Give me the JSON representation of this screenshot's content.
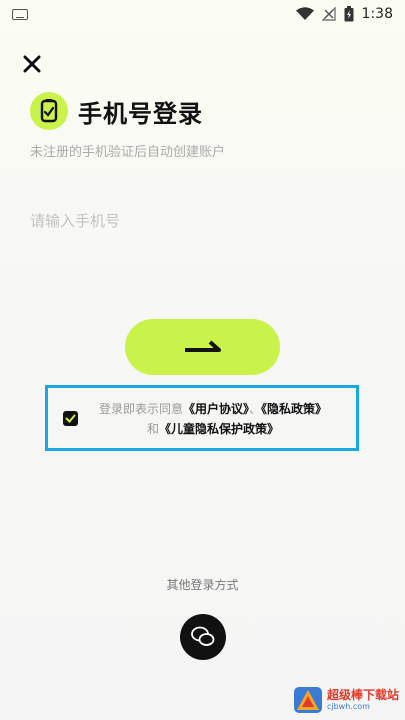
{
  "status_bar": {
    "time": "1:38"
  },
  "header": {
    "title": "手机号登录",
    "subtitle": "未注册的手机验证后自动创建账户"
  },
  "form": {
    "phone_placeholder": "请输入手机号",
    "phone_value": ""
  },
  "agreement": {
    "checked": true,
    "prefix": "登录即表示同意",
    "user_agreement": "《用户协议》",
    "separator": "、",
    "privacy_policy": "《隐私政策》",
    "conjunction": "和",
    "child_privacy": "《儿童隐私保护政策》"
  },
  "other_login": {
    "label": "其他登录方式"
  },
  "watermark": {
    "name": "超级棒下载站",
    "url": "cjbwh.com"
  },
  "colors": {
    "accent": "#c9f24a",
    "highlight_border": "#19a9e1"
  }
}
